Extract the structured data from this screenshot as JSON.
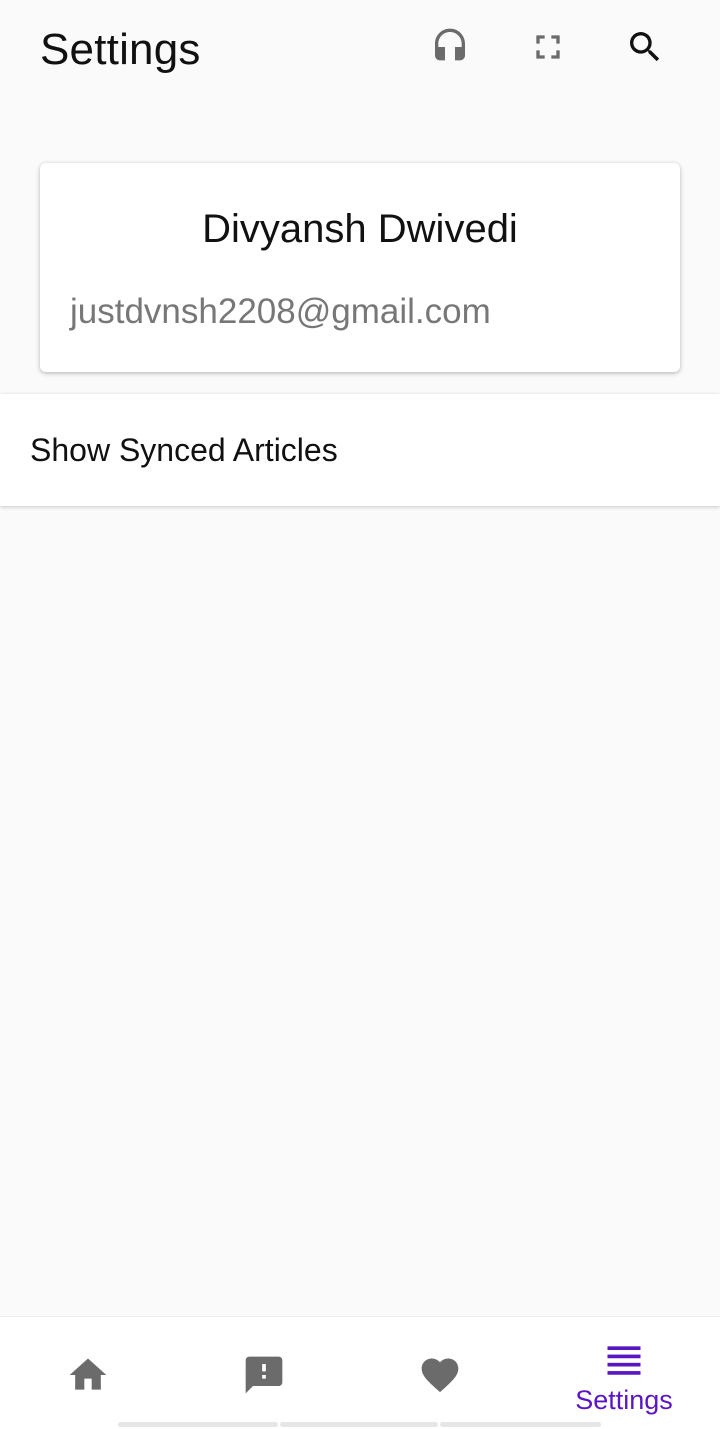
{
  "header": {
    "title": "Settings",
    "actions": [
      {
        "icon": "headphones-icon"
      },
      {
        "icon": "fullscreen-icon"
      },
      {
        "icon": "search-icon"
      }
    ]
  },
  "profile": {
    "name": "Divyansh Dwivedi",
    "email": "justdvnsh2208@gmail.com"
  },
  "settings_list": {
    "items": [
      {
        "label": "Show Synced Articles"
      }
    ]
  },
  "bottom_nav": {
    "items": [
      {
        "icon": "home-icon",
        "label": ""
      },
      {
        "icon": "feedback-icon",
        "label": ""
      },
      {
        "icon": "heart-icon",
        "label": ""
      },
      {
        "icon": "menu-icon",
        "label": "Settings",
        "active": true
      }
    ]
  },
  "colors": {
    "background": "#fafafa",
    "surface": "#ffffff",
    "accent": "#5b16c4",
    "icon_inactive": "#6b6b6b",
    "secondary_text": "#777777"
  }
}
